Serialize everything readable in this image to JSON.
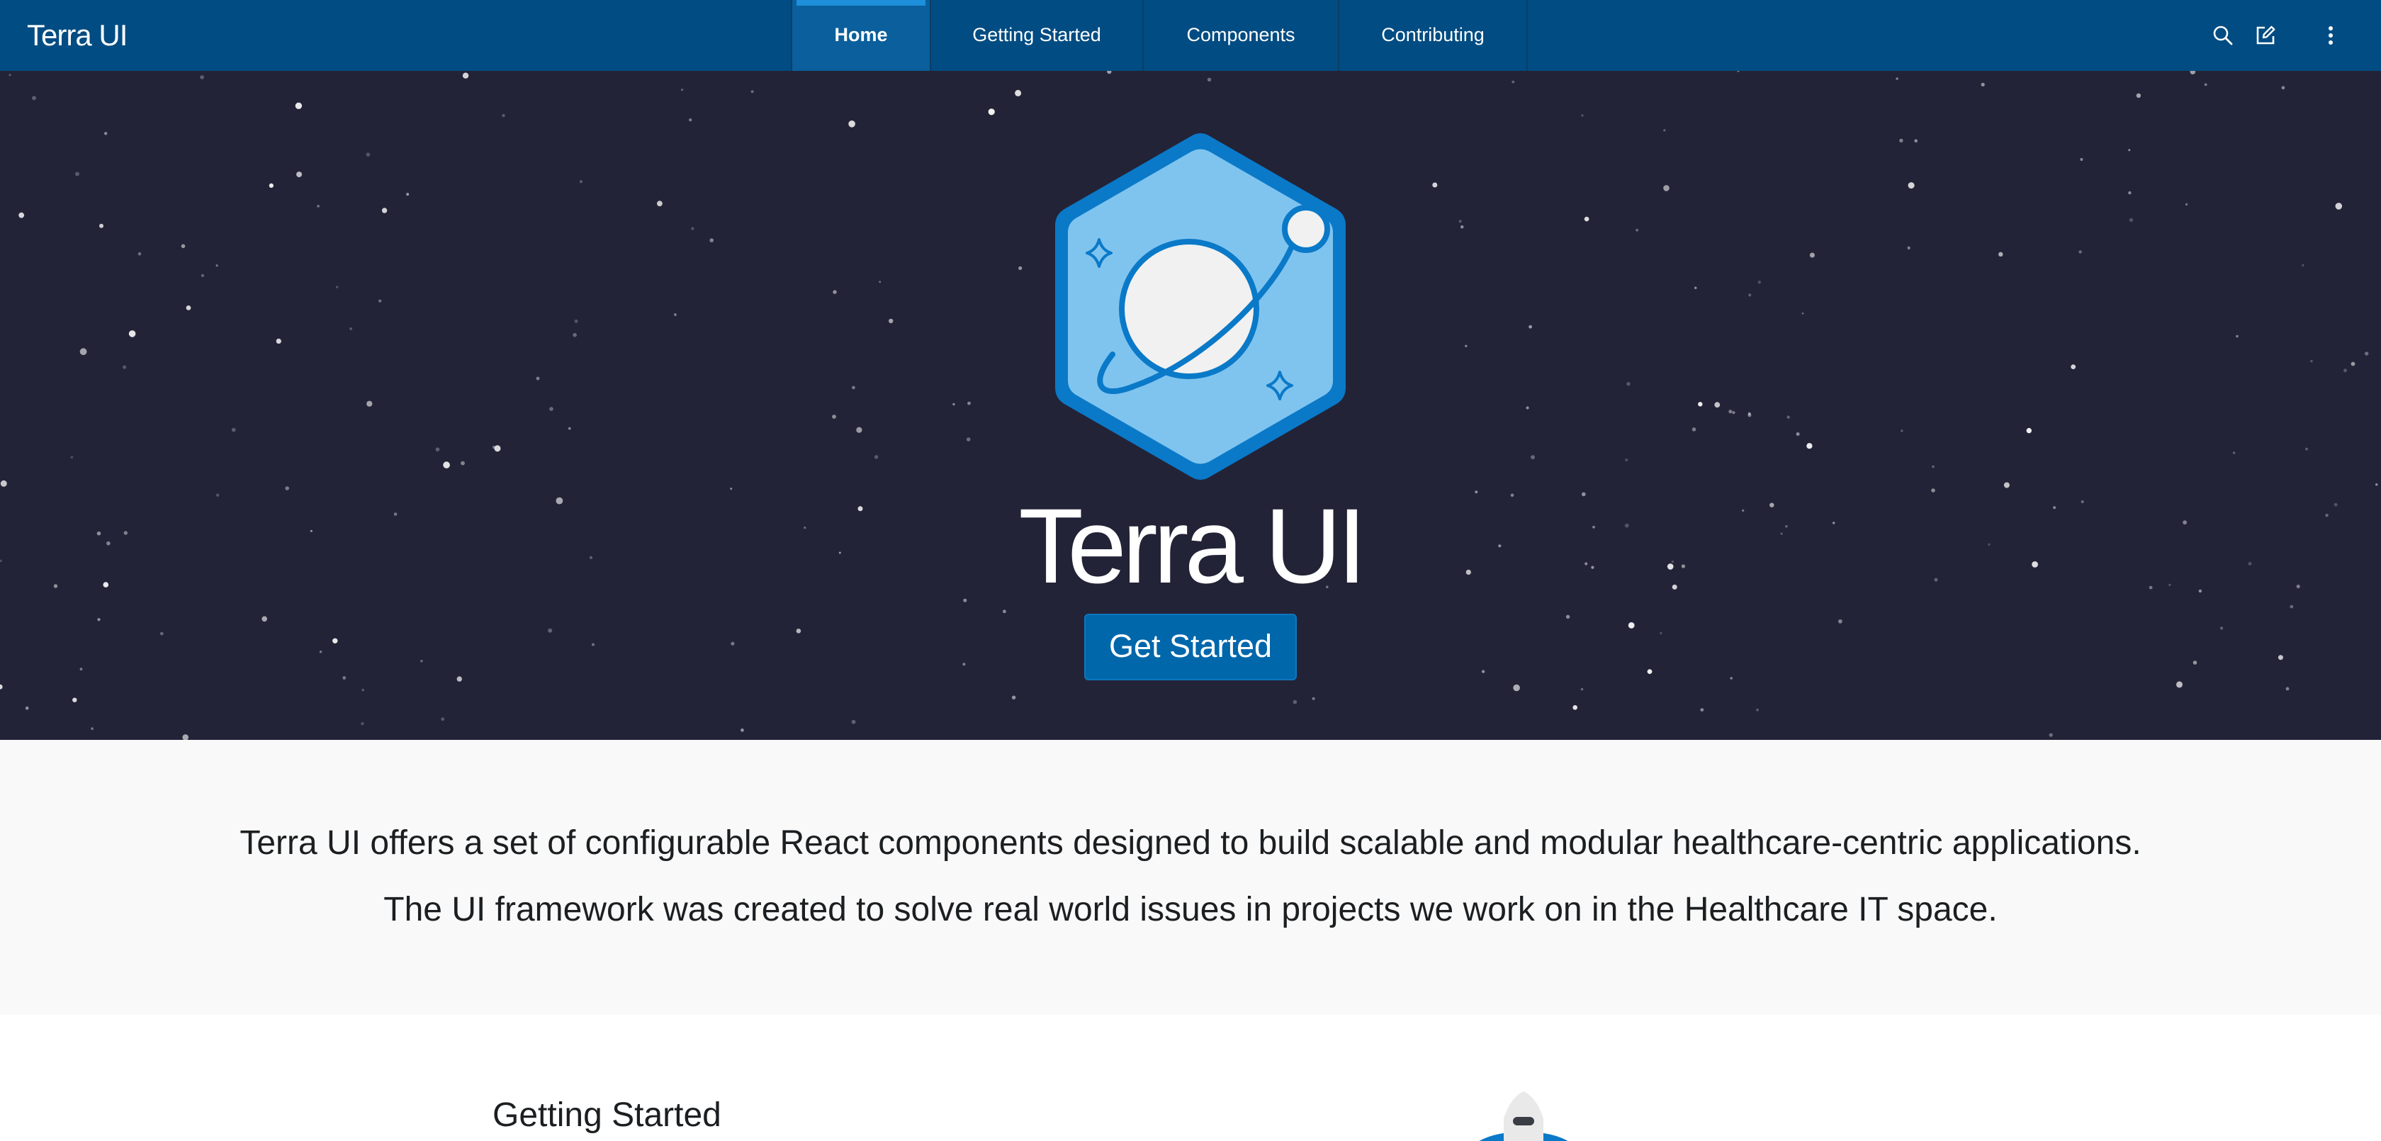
{
  "header": {
    "brand": "Terra UI",
    "tabs": [
      {
        "label": "Home",
        "active": true
      },
      {
        "label": "Getting Started",
        "active": false
      },
      {
        "label": "Components",
        "active": false
      },
      {
        "label": "Contributing",
        "active": false
      }
    ],
    "utilities": [
      {
        "icon": "search-icon"
      },
      {
        "icon": "edit-icon"
      },
      {
        "icon": "more-vertical-icon"
      }
    ]
  },
  "hero": {
    "title": "Terra UI",
    "button_label": "Get Started",
    "logo_icon": "planet-hexagon-icon"
  },
  "intro": {
    "line1": "Terra UI offers a set of configurable React components designed to build scalable and modular healthcare-centric applications.",
    "line2": "The UI framework was created to solve real world issues in projects we work on in the Healthcare IT space."
  },
  "feature": {
    "title": "Getting Started",
    "illustration_icon": "rocket-icon"
  },
  "colors": {
    "header_bg": "#014c82",
    "active_tab_bg": "#0a5f9c",
    "active_tab_indicator": "#1d8fdb",
    "hero_bg": "#232337",
    "button_bg": "#0067ab",
    "intro_bg": "#f9f9f9",
    "logo_light": "#7fc4ef",
    "logo_dark": "#0a79c8"
  }
}
